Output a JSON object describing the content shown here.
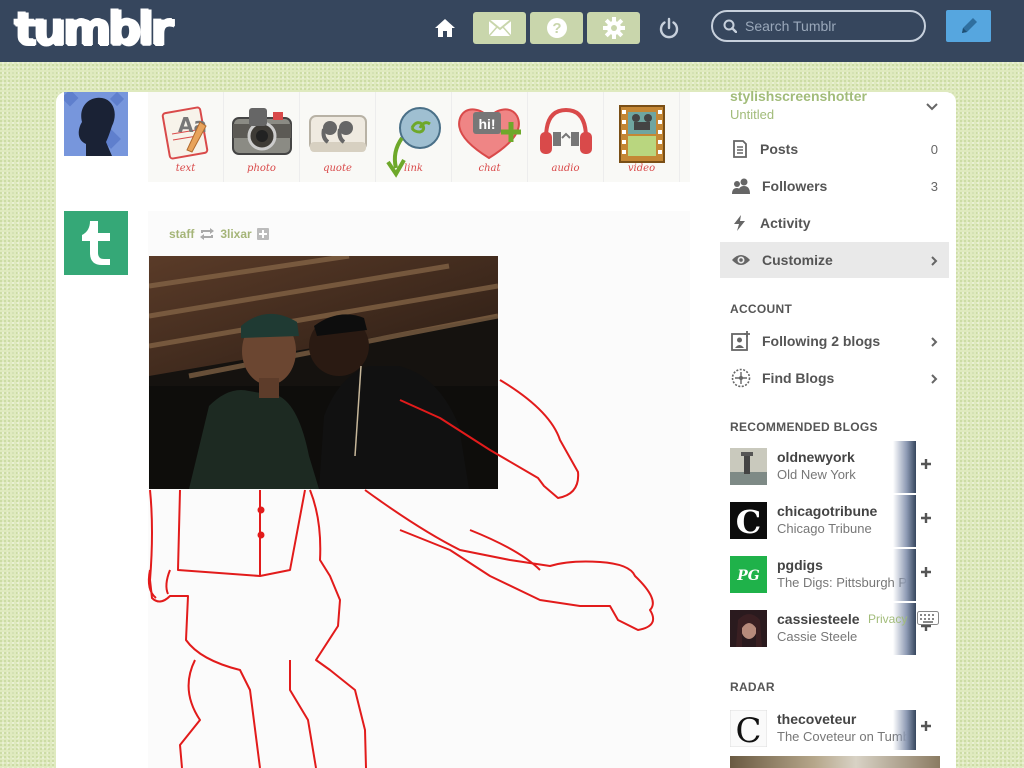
{
  "header": {
    "logo_text": "tumblr",
    "search_placeholder": "Search Tumblr",
    "icons": {
      "home": "home-icon",
      "mail": "mail-icon",
      "help": "help-icon",
      "settings": "gear-icon",
      "power": "power-icon",
      "search": "search-icon",
      "compose": "pencil-icon"
    }
  },
  "post_types": [
    {
      "label": "text",
      "icon": "text-post-icon"
    },
    {
      "label": "photo",
      "icon": "camera-icon"
    },
    {
      "label": "quote",
      "icon": "quote-icon"
    },
    {
      "label": "link",
      "icon": "link-icon"
    },
    {
      "label": "chat",
      "icon": "chat-icon"
    },
    {
      "label": "audio",
      "icon": "headphones-icon"
    },
    {
      "label": "video",
      "icon": "film-icon"
    }
  ],
  "post": {
    "author": "staff",
    "reblogged_from": "3lixar"
  },
  "sidebar": {
    "blog_name": "stylishscreenshotter",
    "blog_title": "Untitled",
    "items": [
      {
        "label": "Posts",
        "count": "0"
      },
      {
        "label": "Followers",
        "count": "3"
      },
      {
        "label": "Activity",
        "count": ""
      },
      {
        "label": "Customize",
        "count": ""
      }
    ],
    "account_heading": "ACCOUNT",
    "account_items": [
      {
        "label": "Following 2 blogs"
      },
      {
        "label": "Find Blogs"
      }
    ],
    "recommended_heading": "RECOMMENDED BLOGS",
    "recommended": [
      {
        "name": "oldnewyork",
        "title": "Old New York"
      },
      {
        "name": "chicagotribune",
        "title": "Chicago Tribune"
      },
      {
        "name": "pgdigs",
        "title": "The Digs: Pittsburgh P"
      },
      {
        "name": "cassiesteele",
        "title": "Cassie Steele"
      }
    ],
    "overlay_text": "Privacy",
    "radar_heading": "RADAR",
    "radar": {
      "name": "thecoveteur",
      "title": "The Coveteur on Tumbl"
    }
  },
  "colors": {
    "header_bg": "#36465d",
    "page_bg": "#dfeabf",
    "accent_green": "#a2bc7a",
    "compose_blue": "#56a6df",
    "staff_green": "#35a877"
  }
}
